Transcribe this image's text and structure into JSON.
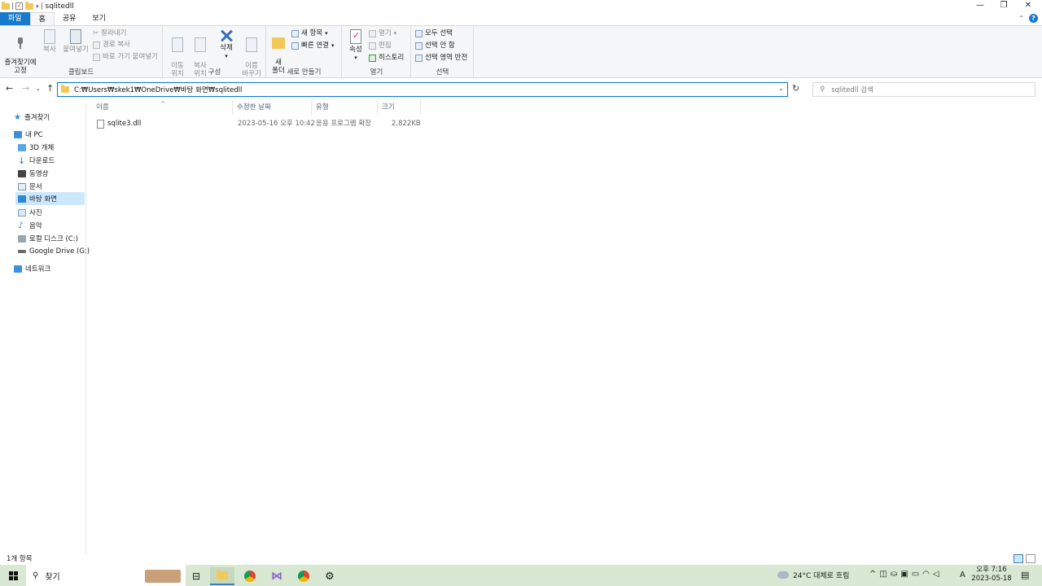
{
  "window": {
    "title": "sqlitedll",
    "controls": {
      "minimize": "—",
      "restore": "❐",
      "close": "✕"
    }
  },
  "ribbon_tabs": [
    "파일",
    "홈",
    "공유",
    "보기"
  ],
  "ribbon": {
    "clipboard": {
      "pin": "즐겨찾기에\n고정",
      "copy": "복사",
      "paste": "붙여넣기",
      "cut": "잘라내기",
      "copy_path": "경로 복사",
      "paste_shortcut": "바로 가기 붙여넣기",
      "label": "클립보드"
    },
    "organize": {
      "move_to": "이동\n위치",
      "copy_to": "복사\n위치",
      "delete": "삭제",
      "rename": "이름\n바꾸기",
      "label": "구성"
    },
    "new": {
      "new_item": "새 항목",
      "easy_access": "빠른 연결",
      "new_folder": "새\n폴더",
      "label": "새로 만들기"
    },
    "open": {
      "properties": "속성",
      "open": "열기",
      "edit": "편집",
      "history": "히스토리",
      "label": "열기"
    },
    "select": {
      "select_all": "모두 선택",
      "select_none": "선택 안 함",
      "invert": "선택 영역 반전",
      "label": "선택"
    }
  },
  "address": {
    "path": "C:₩Users₩skek1₩OneDrive₩바탕 화면₩sqlitedll",
    "search_placeholder": "sqlitedll 검색"
  },
  "navpane": {
    "favorites": "즐겨찾기",
    "this_pc": "내 PC",
    "items": [
      "3D 개체",
      "다운로드",
      "동영상",
      "문서",
      "바탕 화면",
      "사진",
      "음악",
      "로컬 디스크 (C:)",
      "Google Drive (G:)"
    ],
    "network": "네트워크"
  },
  "columns": [
    "이름",
    "수정한 날짜",
    "유형",
    "크기"
  ],
  "files": [
    {
      "name": "sqlite3.dll",
      "modified": "2023-05-16 오후 10:42",
      "type": "응용 프로그램 확장",
      "size": "2,822KB"
    }
  ],
  "status": {
    "count": "1개 항목"
  },
  "taskbar": {
    "search": "찾기",
    "weather": "24°C  대체로 흐림",
    "time": "오후 7:16",
    "date": "2023-05-18",
    "ime": "A"
  }
}
